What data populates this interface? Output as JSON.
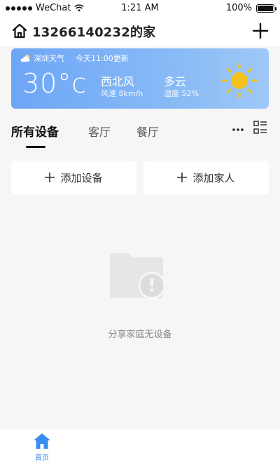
{
  "status_bar": {
    "carrier": "WeChat",
    "time": "1:21 AM",
    "battery": "100%",
    "battery_level": 1.0
  },
  "header": {
    "home_title": "13266140232的家",
    "icons": {
      "home": "home-icon",
      "add": "plus-icon"
    }
  },
  "weather": {
    "city_label": "深圳天气",
    "update_time": "今天11:00更新",
    "temperature": "30°c",
    "wind_direction": "西北风",
    "wind_speed": "风速 8km/h",
    "condition": "多云",
    "humidity": "湿度 52%",
    "icons": {
      "small": "cloud-icon",
      "large": "sun-icon"
    }
  },
  "tabs": [
    {
      "label": "所有设备",
      "active": true
    },
    {
      "label": "客厅",
      "active": false
    },
    {
      "label": "餐厅",
      "active": false
    }
  ],
  "tab_actions": {
    "more": "more-icon",
    "layout": "list-grid-icon"
  },
  "actions": [
    {
      "label": "添加设备",
      "icon": "plus-icon"
    },
    {
      "label": "添加家人",
      "icon": "plus-icon"
    }
  ],
  "empty_state": {
    "text": "分享家庭无设备",
    "icon": "empty-folder-icon"
  },
  "bottom_nav": {
    "items": [
      {
        "label": "首页",
        "icon": "home-icon",
        "active": true
      }
    ]
  },
  "colors": {
    "accent": "#3b8cf0",
    "weather_gradient_start": "#6ea6f6",
    "weather_gradient_end": "#9fc8f7",
    "sun": "#f4c21a"
  }
}
